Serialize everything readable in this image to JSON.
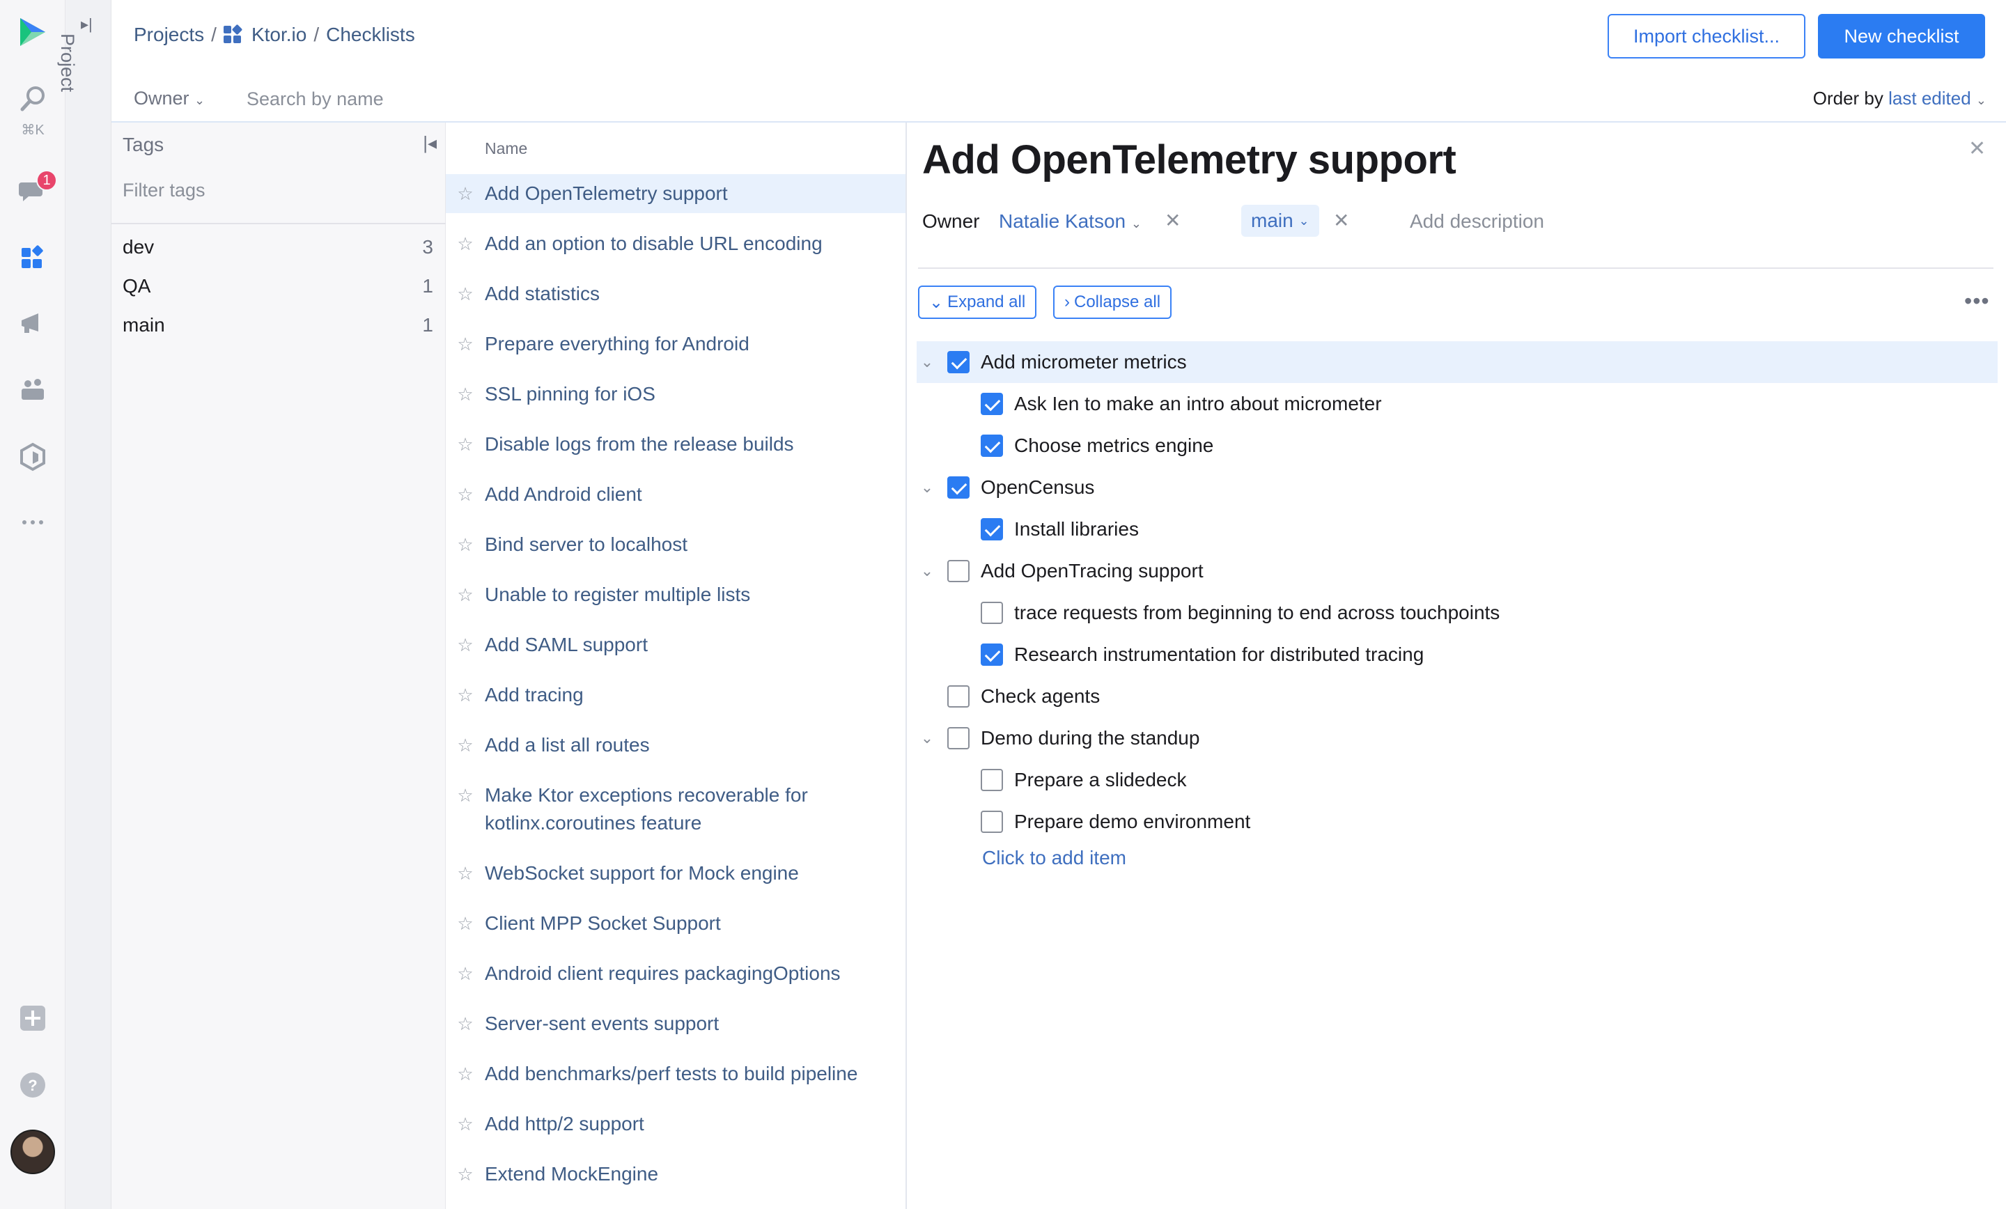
{
  "breadcrumb": {
    "projects": "Projects",
    "sep1": "/",
    "project": "Ktor.io",
    "sep2": "/",
    "section": "Checklists"
  },
  "rail": {
    "shortcut_hint": "⌘K",
    "messages_badge": "1"
  },
  "project_strip": {
    "label": "Project"
  },
  "header": {
    "import_label": "Import checklist...",
    "new_label": "New checklist",
    "owner_filter": "Owner",
    "search_placeholder": "Search by name",
    "order_prefix": "Order by",
    "order_value": "last edited"
  },
  "tags": {
    "title": "Tags",
    "filter_placeholder": "Filter tags",
    "items": [
      {
        "name": "dev",
        "count": "3"
      },
      {
        "name": "QA",
        "count": "1"
      },
      {
        "name": "main",
        "count": "1"
      }
    ]
  },
  "list": {
    "column": "Name",
    "items": [
      "Add OpenTelemetry support",
      "Add an option to disable URL encoding",
      "Add statistics",
      "Prepare everything for Android",
      "SSL pinning for iOS",
      "Disable logs from the release builds",
      "Add Android client",
      "Bind server to localhost",
      "Unable to register multiple lists",
      "Add SAML support",
      "Add tracing",
      "Add a list all routes",
      "Make Ktor exceptions recoverable for kotlinx.coroutines feature",
      "WebSocket support for Mock engine",
      "Client MPP Socket Support",
      "Android client requires packagingOptions",
      "Server-sent events support",
      "Add benchmarks/perf tests to build pipeline",
      "Add http/2 support",
      "Extend MockEngine"
    ]
  },
  "detail": {
    "title": "Add OpenTelemetry support",
    "owner_label": "Owner",
    "owner_value": "Natalie Katson",
    "branch": "main",
    "description_placeholder": "Add description",
    "expand_all": "Expand all",
    "collapse_all": "Collapse all",
    "add_item": "Click to add item",
    "items": [
      {
        "label": "Add micrometer metrics",
        "checked": true,
        "level": 0,
        "collapsible": true,
        "highlight": true
      },
      {
        "label": "Ask Ien to make an intro about micrometer",
        "checked": true,
        "level": 1
      },
      {
        "label": "Choose metrics engine",
        "checked": true,
        "level": 1
      },
      {
        "label": "OpenCensus",
        "checked": true,
        "level": 0,
        "collapsible": true
      },
      {
        "label": "Install libraries",
        "checked": true,
        "level": 1
      },
      {
        "label": "Add OpenTracing support",
        "checked": false,
        "level": 0,
        "collapsible": true
      },
      {
        "label": "trace requests from beginning to end across touchpoints",
        "checked": false,
        "level": 1
      },
      {
        "label": "Research instrumentation for distributed tracing",
        "checked": true,
        "level": 1
      },
      {
        "label": "Check agents",
        "checked": false,
        "level": 0
      },
      {
        "label": "Demo during the standup",
        "checked": false,
        "level": 0,
        "collapsible": true
      },
      {
        "label": "Prepare a slidedeck",
        "checked": false,
        "level": 1
      },
      {
        "label": "Prepare demo environment",
        "checked": false,
        "level": 1
      }
    ]
  },
  "colors": {
    "accent": "#2b7cf2",
    "link": "#3f6fbf",
    "selection": "#e8f1fd",
    "badge": "#e8456b"
  }
}
